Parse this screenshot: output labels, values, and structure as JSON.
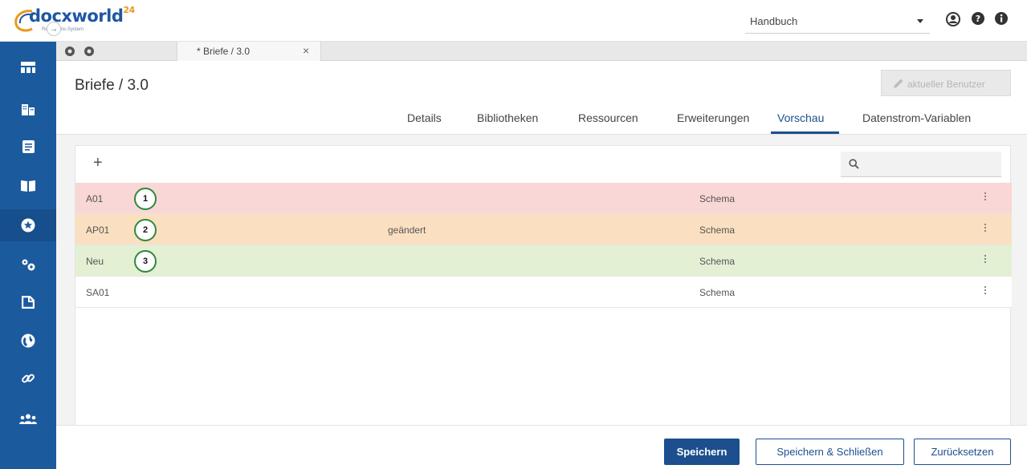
{
  "app": {
    "logo_text": "docxworld",
    "logo_sup": "24",
    "logo_sub": "Redaktions-System"
  },
  "topbar": {
    "selector_value": "Handbuch",
    "icons": [
      "user-circle-icon",
      "help-icon",
      "info-icon"
    ]
  },
  "sidebar": {
    "items": [
      {
        "icon": "dashboard-icon",
        "active": false
      },
      {
        "icon": "building-icon",
        "active": false
      },
      {
        "icon": "document-icon",
        "active": false
      },
      {
        "icon": "book-icon",
        "active": false
      },
      {
        "icon": "star-circle-icon",
        "active": true
      },
      {
        "icon": "cogs-icon",
        "active": false
      },
      {
        "icon": "file-icon",
        "active": false
      },
      {
        "icon": "globe-icon",
        "active": false
      },
      {
        "icon": "link-icon",
        "active": false
      },
      {
        "icon": "users-icon",
        "active": false
      }
    ]
  },
  "tabstrip": {
    "tab_label": "* Briefe / 3.0"
  },
  "page": {
    "title": "Briefe / 3.0",
    "user_button": "aktueller Benutzer"
  },
  "tabs": [
    {
      "label": "Details",
      "active": false
    },
    {
      "label": "Bibliotheken",
      "active": false
    },
    {
      "label": "Ressourcen",
      "active": false
    },
    {
      "label": "Erweiterungen",
      "active": false
    },
    {
      "label": "Vorschau",
      "active": true
    },
    {
      "label": "Datenstrom-Variablen",
      "active": false
    }
  ],
  "toolbar": {
    "add_label": "+",
    "search_placeholder": ""
  },
  "rows": [
    {
      "name": "A01",
      "status": "",
      "type": "Schema",
      "badge": "1",
      "color": "#f9d7d6"
    },
    {
      "name": "AP01",
      "status": "geändert",
      "type": "Schema",
      "badge": "2",
      "color": "#fae0c0"
    },
    {
      "name": "Neu",
      "status": "",
      "type": "Schema",
      "badge": "3",
      "color": "#e3f0d4"
    },
    {
      "name": "SA01",
      "status": "",
      "type": "Schema",
      "badge": "",
      "color": "#ffffff"
    }
  ],
  "footer": {
    "save": "Speichern",
    "save_close": "Speichern & Schließen",
    "reset": "Zurücksetzen"
  },
  "colors": {
    "brand_blue": "#1c5a9e",
    "accent_blue": "#1d4f8f",
    "badge_green": "#2d8a3a"
  }
}
